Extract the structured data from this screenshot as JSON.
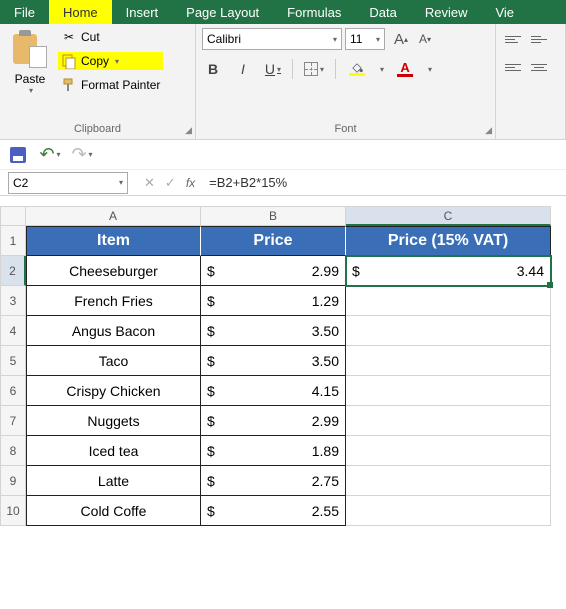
{
  "tabs": [
    "File",
    "Home",
    "Insert",
    "Page Layout",
    "Formulas",
    "Data",
    "Review",
    "Vie"
  ],
  "clipboard": {
    "paste": "Paste",
    "cut": "Cut",
    "copy": "Copy",
    "format_painter": "Format Painter",
    "group_label": "Clipboard"
  },
  "font": {
    "name": "Calibri",
    "size": "11",
    "group_label": "Font"
  },
  "name_box": "C2",
  "formula": "=B2+B2*15%",
  "columns": [
    "A",
    "B",
    "C"
  ],
  "header_row": {
    "item": "Item",
    "price": "Price",
    "vat": "Price (15% VAT)"
  },
  "rows": [
    {
      "n": "1"
    },
    {
      "n": "2",
      "item": "Cheeseburger",
      "cur": "$",
      "price": "2.99",
      "vcur": "$",
      "vprice": "3.44"
    },
    {
      "n": "3",
      "item": "French Fries",
      "cur": "$",
      "price": "1.29"
    },
    {
      "n": "4",
      "item": "Angus Bacon",
      "cur": "$",
      "price": "3.50"
    },
    {
      "n": "5",
      "item": "Taco",
      "cur": "$",
      "price": "3.50"
    },
    {
      "n": "6",
      "item": "Crispy Chicken",
      "cur": "$",
      "price": "4.15"
    },
    {
      "n": "7",
      "item": "Nuggets",
      "cur": "$",
      "price": "2.99"
    },
    {
      "n": "8",
      "item": "Iced tea",
      "cur": "$",
      "price": "1.89"
    },
    {
      "n": "9",
      "item": "Latte",
      "cur": "$",
      "price": "2.75"
    },
    {
      "n": "10",
      "item": "Cold Coffe",
      "cur": "$",
      "price": "2.55"
    }
  ]
}
